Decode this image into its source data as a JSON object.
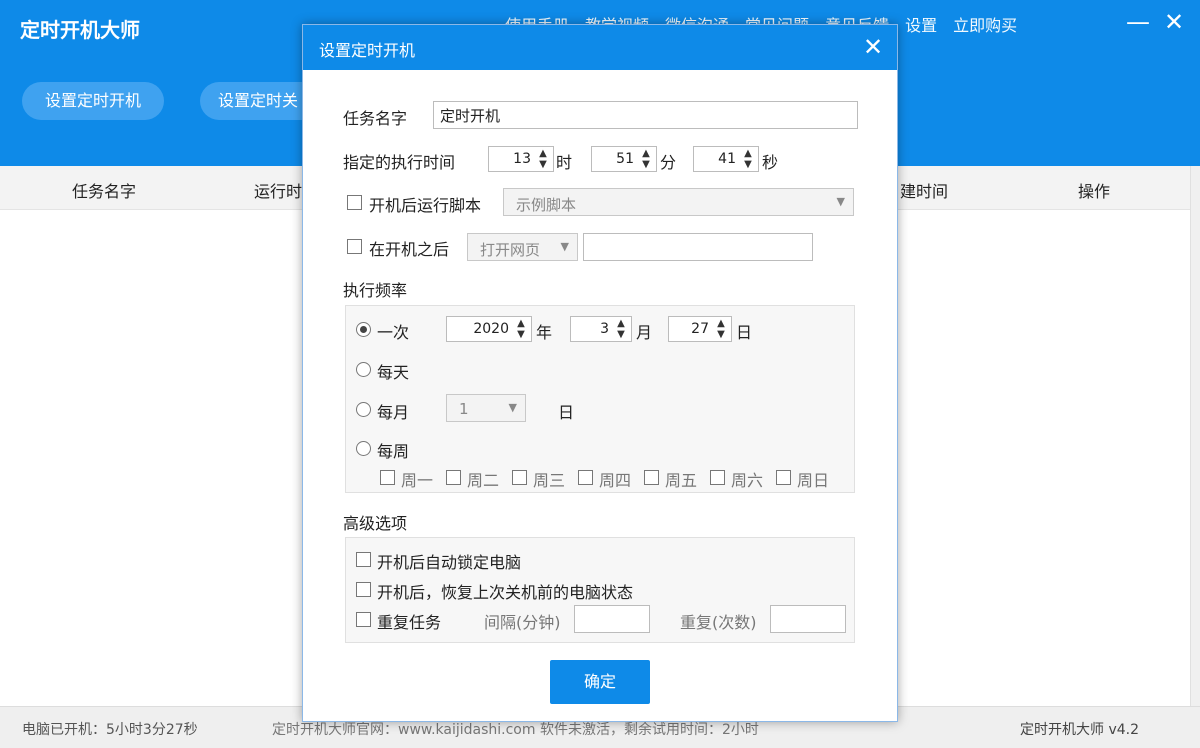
{
  "app": {
    "title": "定时开机大师",
    "links": [
      "使用手册",
      "教学视频",
      "微信沟通",
      "常见问题",
      "意见反馈",
      "设置",
      "立即购买"
    ],
    "min_icon": "minimize-icon",
    "close_icon": "close-icon",
    "buttons": {
      "set_power_on": "设置定时开机",
      "set_power_off": "设置定时关"
    }
  },
  "table": {
    "headers": {
      "task_name": "任务名字",
      "run_time": "运行时",
      "created_time": "建时间",
      "action": "操作"
    }
  },
  "status": {
    "uptime": "电脑已开机：5小时3分27秒",
    "site": "定时开机大师官网：www.kaijidashi.com 软件未激活，剩余试用时间：2小时",
    "version": "定时开机大师 v4.2"
  },
  "dialog": {
    "title": "设置定时开机",
    "task_name_label": "任务名字",
    "task_name_value": "定时开机",
    "exec_time_label": "指定的执行时间",
    "hour": "13",
    "hour_unit": "时",
    "minute": "51",
    "minute_unit": "分",
    "second": "41",
    "second_unit": "秒",
    "run_script_label": "开机后运行脚本",
    "run_script_select": "示例脚本",
    "after_boot_label": "在开机之后",
    "after_boot_select": "打开网页",
    "after_boot_value": "",
    "freq_label": "执行频率",
    "freq": {
      "once": "一次",
      "year": "2020",
      "year_unit": "年",
      "month": "3",
      "month_unit": "月",
      "day": "27",
      "day_unit": "日",
      "daily": "每天",
      "monthly": "每月",
      "monthly_day": "1",
      "monthly_day_unit": "日",
      "weekly": "每周",
      "weekdays": [
        "周一",
        "周二",
        "周三",
        "周四",
        "周五",
        "周六",
        "周日"
      ]
    },
    "adv_label": "高级选项",
    "adv": {
      "lock": "开机后自动锁定电脑",
      "restore": "开机后，恢复上次关机前的电脑状态",
      "repeat": "重复任务",
      "interval_label": "间隔(分钟)",
      "repeat_count_label": "重复(次数)"
    },
    "ok": "确定"
  }
}
